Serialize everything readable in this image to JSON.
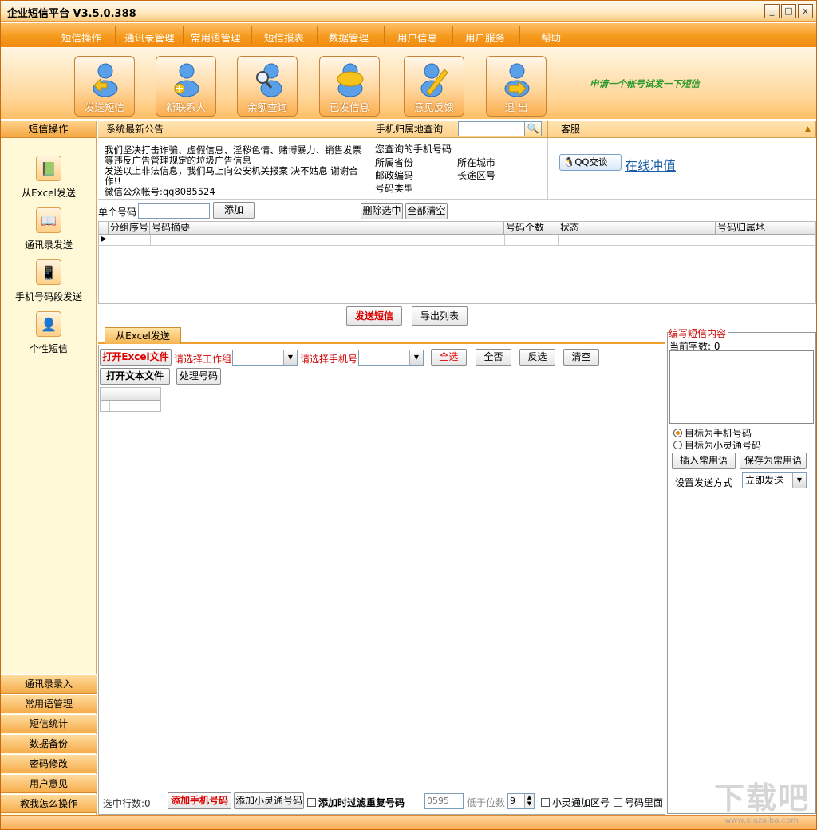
{
  "window": {
    "title": "企业短信平台 V3.5.0.388",
    "min": "_",
    "max": "□",
    "close": "x"
  },
  "menu": [
    "短信操作",
    "通讯录管理",
    "常用语管理",
    "短信报表",
    "数据管理",
    "用户信息",
    "用户服务",
    "帮助"
  ],
  "toolbar": {
    "buttons": [
      "发送短信",
      "新联系人",
      "余额查询",
      "已发信息",
      "意见反馈",
      "退 出"
    ],
    "slogan": "申请一个帐号试发一下短信"
  },
  "left": {
    "header": "短信操作",
    "items": [
      "从Excel发送",
      "通讯录发送",
      "手机号码段发送",
      "个性短信"
    ],
    "bottom": [
      "通讯录录入",
      "常用语管理",
      "短信统计",
      "数据备份",
      "密码修改",
      "用户意见",
      "教我怎么操作"
    ]
  },
  "notice": {
    "header": "系统最新公告",
    "text": "我们坚决打击诈骗、虚假信息、淫秽色情、赌博暴力、销售发票等违反广告管理规定的垃圾广告信息\n发送以上非法信息，我们马上向公安机关报案 决不姑息 谢谢合作!!\n微信公众帐号:qq8085524"
  },
  "lookup": {
    "header": "手机归属地查询",
    "query_label": "您查询的手机号码",
    "province": "所属省份",
    "city": "所在城市",
    "postcode": "邮政编码",
    "areacode": "长途区号",
    "type": "号码类型"
  },
  "service": {
    "header": "客服",
    "qq": "QQ交谈",
    "recharge": "在线冲值"
  },
  "single": {
    "label": "单个号码",
    "add": "添加",
    "delete_sel": "删除选中",
    "clear_all": "全部清空"
  },
  "table": {
    "columns": [
      "分组序号",
      "号码摘要",
      "号码个数",
      "状态",
      "号码归属地"
    ]
  },
  "actions": {
    "send": "发送短信",
    "export": "导出列表"
  },
  "tab": {
    "label": "从Excel发送"
  },
  "excel": {
    "open_excel": "打开Excel文件",
    "choose_sheet": "请选择工作组",
    "choose_phone": "请选择手机号",
    "select_all": "全选",
    "select_none": "全否",
    "invert": "反选",
    "clear": "清空",
    "open_text": "打开文本文件",
    "process": "处理号码"
  },
  "bottom": {
    "selected_rows": "选中行数:0",
    "add_phone": "添加手机号码",
    "add_phs": "添加小灵通号码",
    "filter_dup": "添加时过滤重复号码",
    "area_value": "0595",
    "digits_label": "低于位数",
    "digits_value": "9",
    "phs_area": "小灵通加区号",
    "inside": "号码里面"
  },
  "compose": {
    "legend": "编写短信内容",
    "count": "当前字数: 0",
    "target_phone": "目标为手机号码",
    "target_phs": "目标为小灵通号码",
    "insert_common": "插入常用语",
    "save_common": "保存为常用语",
    "send_mode_label": "设置发送方式",
    "send_mode": "立即发送"
  },
  "watermark": {
    "main": "下载吧",
    "sub": "www.xiazaiba.com"
  }
}
